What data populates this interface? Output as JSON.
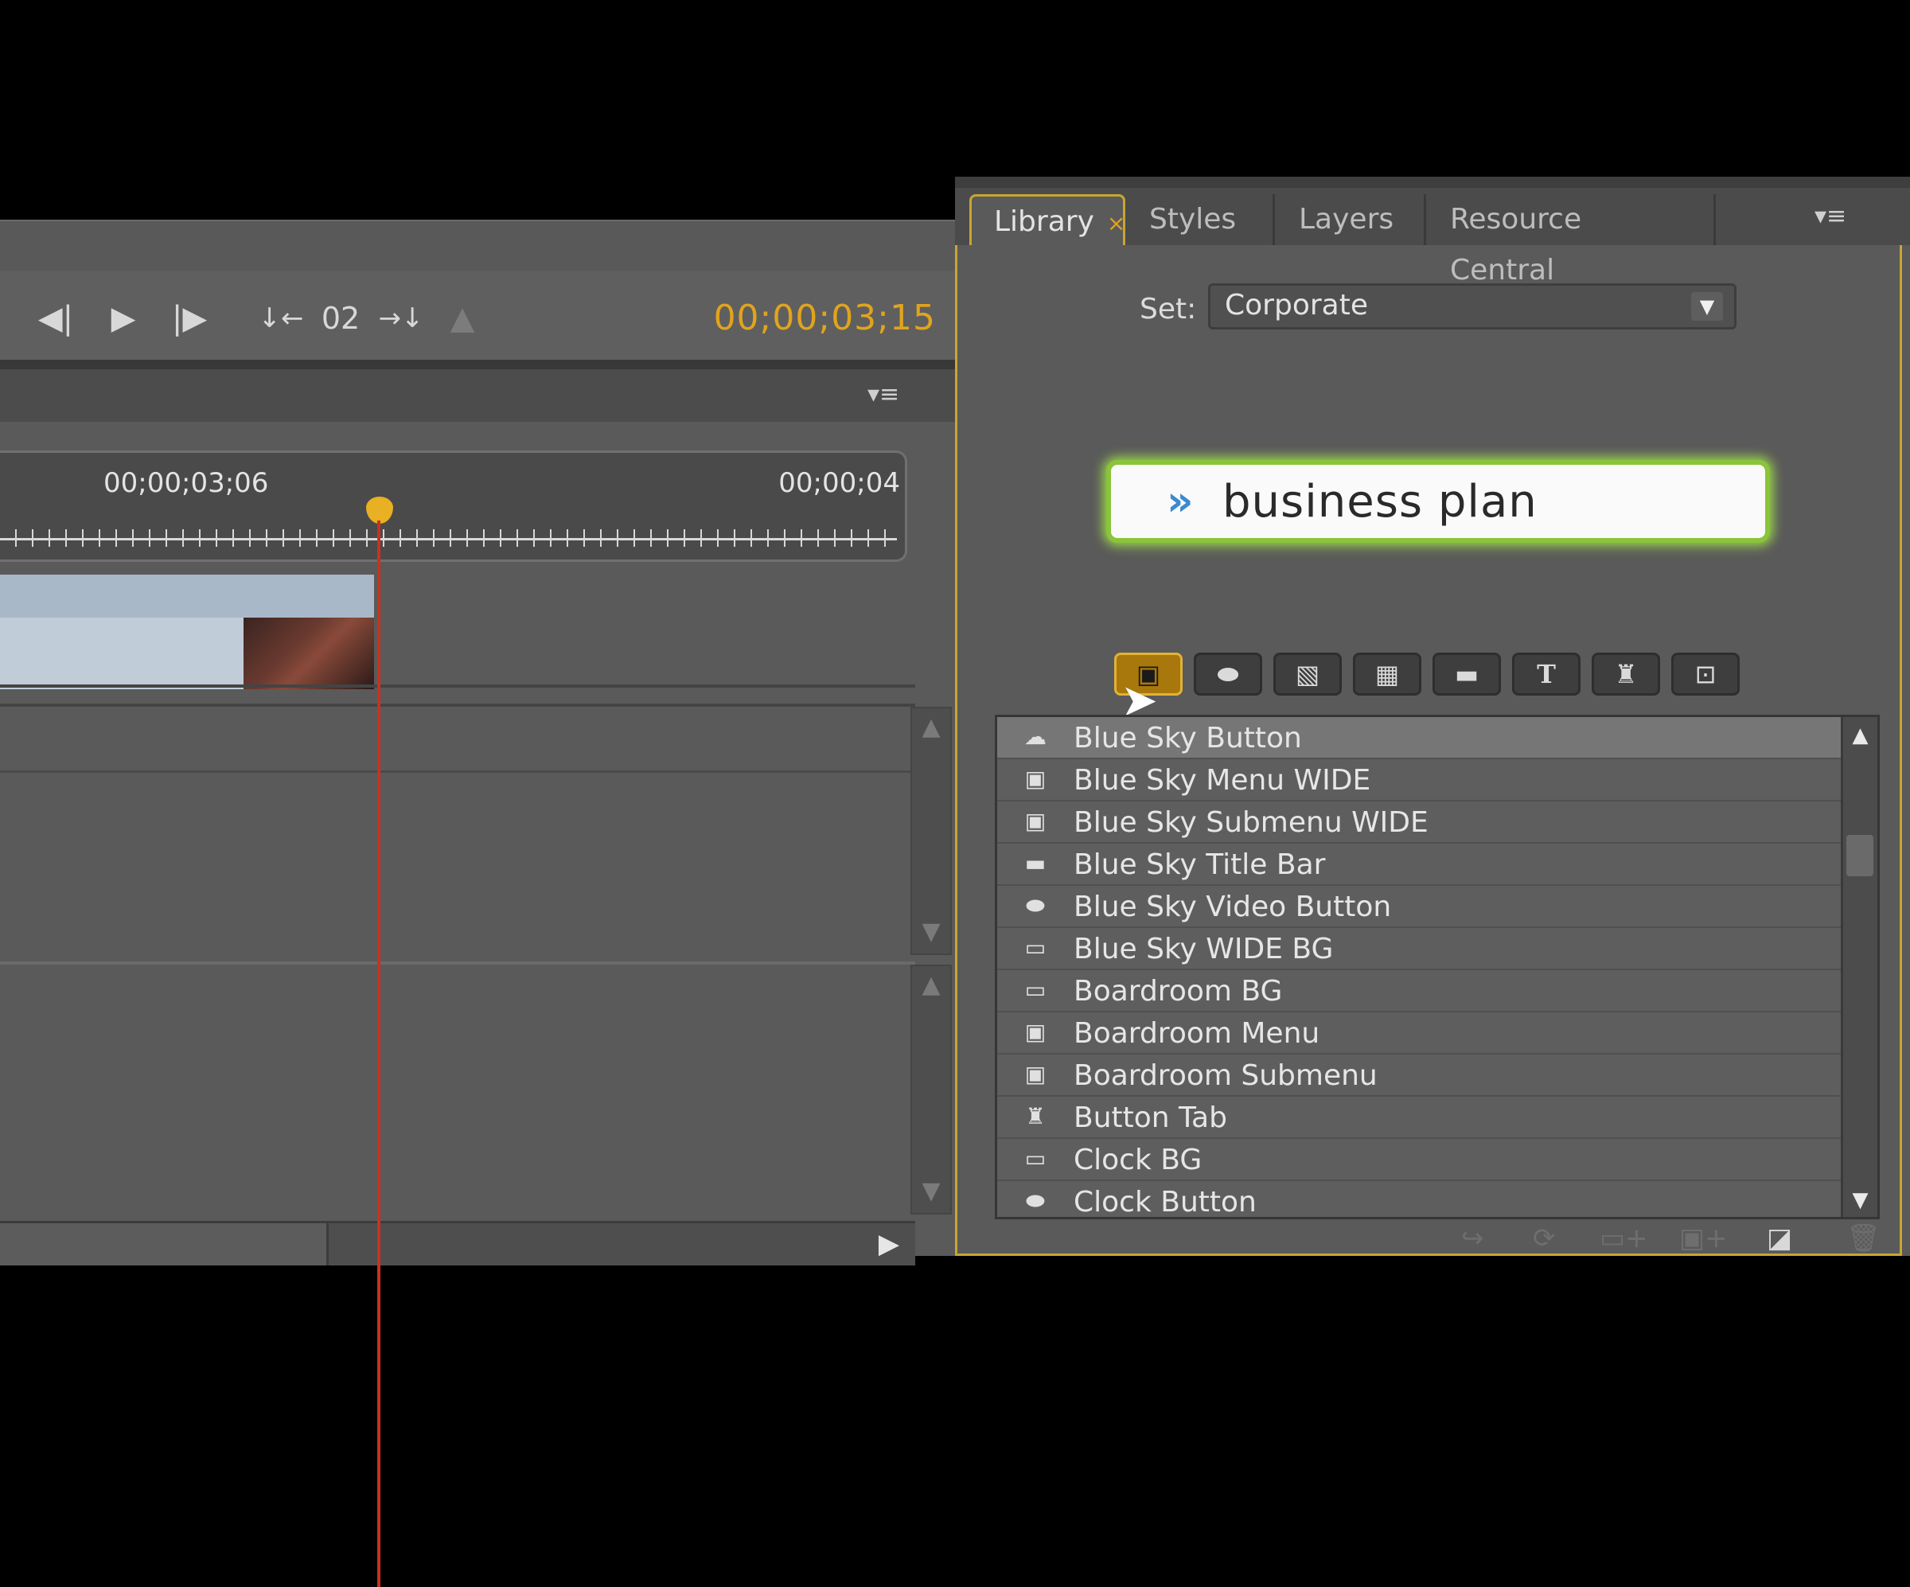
{
  "monitor": {
    "controls": {
      "prev_frame": "◀|",
      "play": "▶",
      "next_frame": "|▶",
      "mark_in": "↓←",
      "frame_count": "02",
      "mark_out": "→↓",
      "marker": "▲"
    },
    "timecode": "00;00;03;15",
    "timecode_color": "#e0a41c"
  },
  "timeline": {
    "menu_icon": "▾≡",
    "ruler_start": "00;00;03;06",
    "ruler_end": "00;00;04",
    "scroll_up": "▲",
    "scroll_down": "▼",
    "scroll_right": "▶"
  },
  "library_panel": {
    "tabs": [
      {
        "label": "Library",
        "close": "×"
      },
      {
        "label": "Styles"
      },
      {
        "label": "Layers"
      },
      {
        "label": "Resource Central"
      }
    ],
    "menu_icon": "▾≡",
    "set_label": "Set:",
    "set_value": "Corporate",
    "preview": {
      "chevrons": "»",
      "text": "business plan"
    },
    "filter_buttons": [
      {
        "name": "menus",
        "glyph": "▣",
        "active": true
      },
      {
        "name": "buttons",
        "glyph": "⬬"
      },
      {
        "name": "images",
        "glyph": "▧"
      },
      {
        "name": "backgrounds",
        "glyph": "▦"
      },
      {
        "name": "frames",
        "glyph": "▬"
      },
      {
        "name": "text",
        "glyph": "T"
      },
      {
        "name": "graphics",
        "glyph": "♜"
      },
      {
        "name": "video",
        "glyph": "⊡"
      }
    ],
    "items": [
      {
        "icon": "☁",
        "label": "Blue Sky Button"
      },
      {
        "icon": "▣",
        "label": "Blue Sky Menu WIDE"
      },
      {
        "icon": "▣",
        "label": "Blue Sky Submenu WIDE"
      },
      {
        "icon": "▬",
        "label": "Blue Sky Title Bar"
      },
      {
        "icon": "⬬",
        "label": "Blue Sky Video Button"
      },
      {
        "icon": "▭",
        "label": "Blue Sky WIDE BG"
      },
      {
        "icon": "▭",
        "label": "Boardroom BG"
      },
      {
        "icon": "▣",
        "label": "Boardroom Menu"
      },
      {
        "icon": "▣",
        "label": "Boardroom Submenu"
      },
      {
        "icon": "♜",
        "label": "Button Tab"
      },
      {
        "icon": "▭",
        "label": "Clock BG"
      },
      {
        "icon": "⬬",
        "label": "Clock Button"
      }
    ],
    "scroll_up": "▲",
    "scroll_down": "▼",
    "bottom_tools": [
      "↪",
      "⟳",
      "▭+",
      "▣+",
      "◪",
      "🗑"
    ]
  }
}
